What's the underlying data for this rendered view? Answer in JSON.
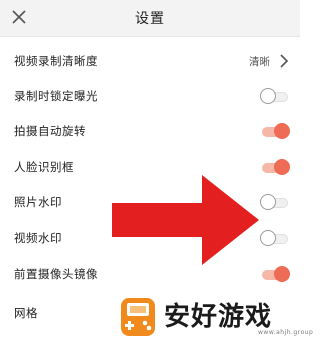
{
  "header": {
    "title": "设置",
    "close_icon": "close-icon"
  },
  "settings": [
    {
      "label": "视频录制清晰度",
      "value": "清晰",
      "control": "chevron"
    },
    {
      "label": "录制时锁定曝光",
      "control": "toggle",
      "on": false
    },
    {
      "label": "拍摄自动旋转",
      "control": "toggle",
      "on": true
    },
    {
      "label": "人脸识别框",
      "control": "toggle",
      "on": true
    },
    {
      "label": "照片水印",
      "control": "toggle",
      "on": false
    },
    {
      "label": "视频水印",
      "control": "toggle",
      "on": false
    },
    {
      "label": "前置摄像头镜像",
      "control": "toggle",
      "on": true
    },
    {
      "label": "网格",
      "control": "toggle",
      "on": false
    }
  ],
  "colors": {
    "accent": "#ee6b55",
    "arrow": "#e41f1f",
    "logo": "#f08a1c"
  },
  "overlay": {
    "arrow_icon": "red-arrow-icon"
  },
  "watermark": {
    "text": "安好游戏",
    "sub": "www.ahjh.group"
  }
}
